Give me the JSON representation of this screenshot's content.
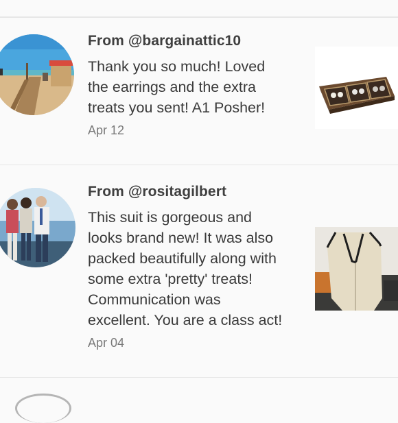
{
  "reviews": [
    {
      "from": "From @bargainattic10",
      "message": "Thank you so much! Loved\nthe earrings and the extra\ntreats you sent! A1 Posher!",
      "date": "Apr 12"
    },
    {
      "from": "From @rositagilbert",
      "message": "This suit is gorgeous and\nlooks brand new! It was also\npacked beautifully along with\nsome extra 'pretty' treats!\nCommunication was\nexcellent. You are a class act!",
      "date": "Apr 04"
    }
  ]
}
